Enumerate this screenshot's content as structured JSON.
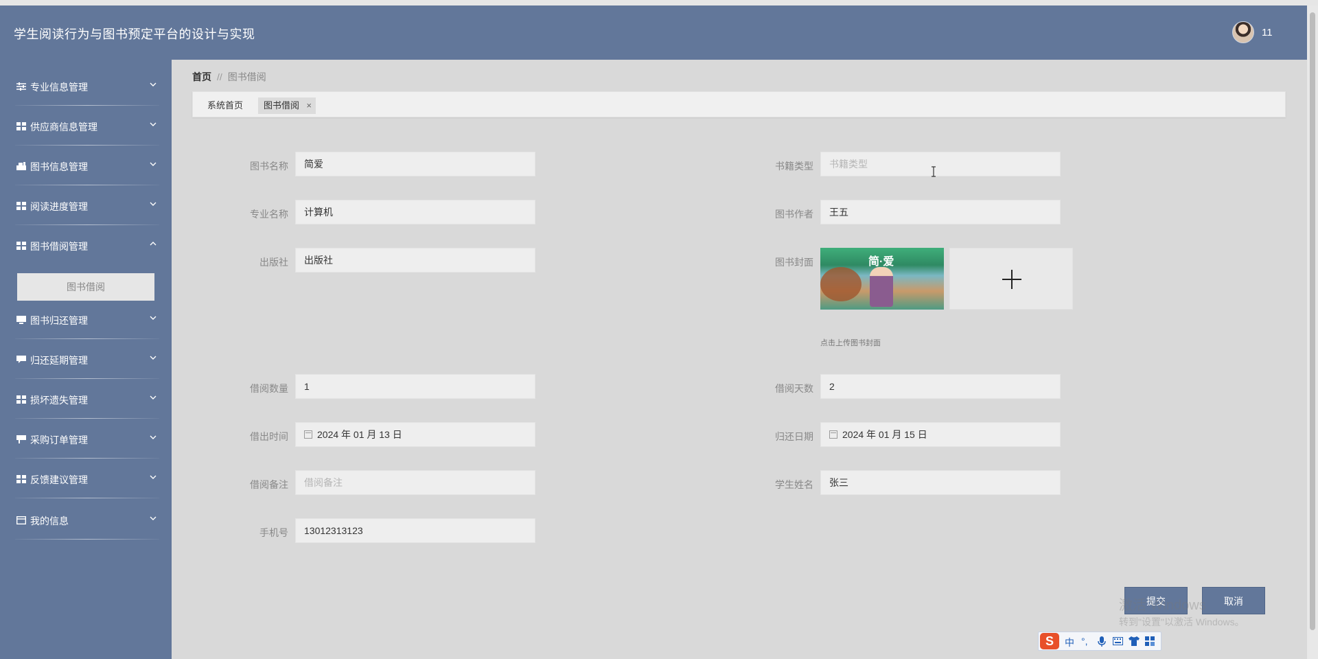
{
  "app": {
    "title": "学生阅读行为与图书预定平台的设计与实现",
    "username": "11"
  },
  "sidebar": {
    "items": [
      {
        "label": "专业信息管理",
        "icon": "sliders-icon"
      },
      {
        "label": "供应商信息管理",
        "icon": "grid-icon"
      },
      {
        "label": "图书信息管理",
        "icon": "book-stack-icon"
      },
      {
        "label": "阅读进度管理",
        "icon": "grid-icon"
      },
      {
        "label": "图书借阅管理",
        "icon": "grid-icon",
        "expanded": true
      },
      {
        "label": "图书归还管理",
        "icon": "monitor-icon"
      },
      {
        "label": "归还延期管理",
        "icon": "chat-icon"
      },
      {
        "label": "损坏遗失管理",
        "icon": "grid-icon"
      },
      {
        "label": "采购订单管理",
        "icon": "flag-icon"
      },
      {
        "label": "反馈建议管理",
        "icon": "grid-icon"
      },
      {
        "label": "我的信息",
        "icon": "window-icon"
      }
    ],
    "submenu_active": "图书借阅"
  },
  "breadcrumb": {
    "home": "首页",
    "separator": "//",
    "current": "图书借阅"
  },
  "tabs": [
    {
      "label": "系统首页"
    },
    {
      "label": "图书借阅",
      "close": "×",
      "active": true
    }
  ],
  "form": {
    "book_name": {
      "label": "图书名称",
      "value": "简爱"
    },
    "book_type": {
      "label": "书籍类型",
      "value": "",
      "placeholder": "书籍类型"
    },
    "major_name": {
      "label": "专业名称",
      "value": "计算机"
    },
    "author": {
      "label": "图书作者",
      "value": "王五"
    },
    "publisher": {
      "label": "出版社",
      "value": "出版社"
    },
    "cover": {
      "label": "图书封面",
      "hint": "点击上传图书封面",
      "image_title": "简·爱"
    },
    "borrow_qty": {
      "label": "借阅数量",
      "value": "1"
    },
    "borrow_days": {
      "label": "借阅天数",
      "value": "2"
    },
    "borrow_time": {
      "label": "借出时间",
      "value": "2024 年 01 月 13 日"
    },
    "return_date": {
      "label": "归还日期",
      "value": "2024 年 01 月 15 日"
    },
    "remark": {
      "label": "借阅备注",
      "value": "",
      "placeholder": "借阅备注"
    },
    "student_name": {
      "label": "学生姓名",
      "value": "张三"
    },
    "phone": {
      "label": "手机号",
      "value": "13012313123"
    }
  },
  "buttons": {
    "submit": "提交",
    "cancel": "取消"
  },
  "watermark": {
    "line1": "激活 Windows",
    "line2": "转到\"设置\"以激活 Windows。"
  },
  "ime": {
    "logo": "S",
    "lang": "中",
    "punct": "°,"
  },
  "colors": {
    "header_bg": "#62779a",
    "sidebar_bg": "#62779a",
    "content_bg": "#d9d9d9",
    "button_bg": "#62779a"
  }
}
